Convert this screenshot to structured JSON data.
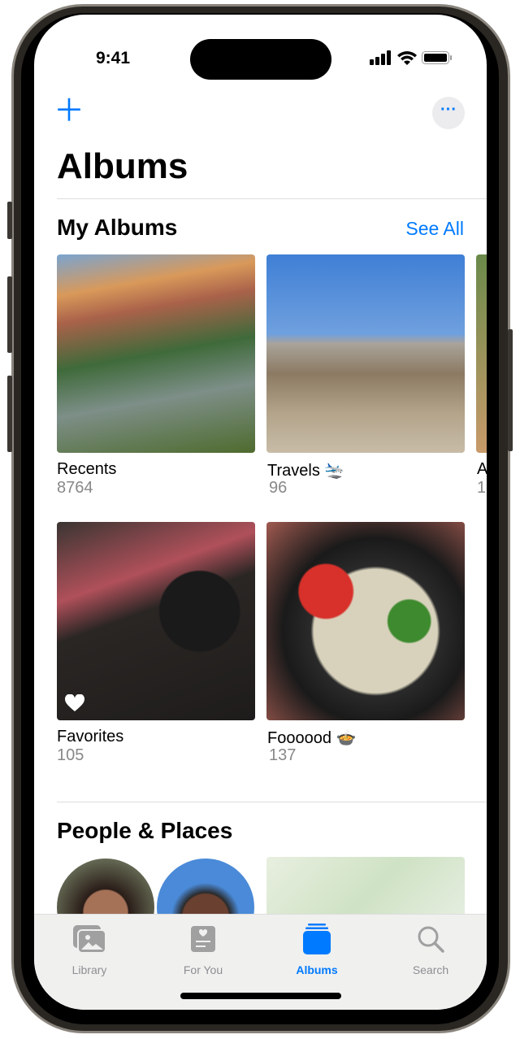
{
  "status": {
    "time": "9:41"
  },
  "header": {
    "add_icon": "plus-icon",
    "more_icon": "ellipsis-icon",
    "title": "Albums"
  },
  "my_albums": {
    "title": "My Albums",
    "see_all": "See All",
    "albums": [
      {
        "name": "Recents",
        "count": "8764"
      },
      {
        "name": "Travels 🛬",
        "count": "96"
      },
      {
        "name": "A",
        "count": "1"
      },
      {
        "name": "Favorites",
        "count": "105"
      },
      {
        "name": "Foooood 🍲",
        "count": "137"
      }
    ]
  },
  "people_places": {
    "title": "People & Places"
  },
  "tabs": [
    {
      "label": "Library",
      "icon": "photo-stack-icon"
    },
    {
      "label": "For You",
      "icon": "for-you-icon"
    },
    {
      "label": "Albums",
      "icon": "albums-icon",
      "active": true
    },
    {
      "label": "Search",
      "icon": "search-icon"
    }
  ],
  "colors": {
    "accent": "#007aff"
  }
}
